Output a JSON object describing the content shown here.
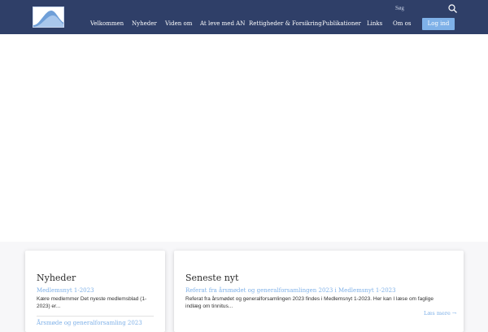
{
  "header": {
    "search_label": "Søg",
    "nav": [
      "Velkommen",
      "Nyheder",
      "Viden om",
      "At leve med AN",
      "Rettigheder & Forsikring",
      "Publikationer",
      "Links",
      "Om os"
    ],
    "login_label": "Log ind"
  },
  "news_card": {
    "title": "Nyheder",
    "items": [
      {
        "title": "Medlemsnyt 1-2023",
        "excerpt": "Kære medlemmer Det nyeste medlemsblad (1-2023) er..."
      },
      {
        "title": "Årsmøde og generalforsamling 2023",
        "excerpt": ""
      }
    ]
  },
  "latest_card": {
    "title": "Seneste nyt",
    "item_title": "Referat fra årsmødet og generalforsamlingen 2023 i Medlemsnyt 1-2023",
    "item_excerpt": "Referat fra årsmødet og generalforsamlingen 2023 findes i Medlemsnyt 1-2023. Her kan I læse om faglige indlæg om tinnitus...",
    "read_more": "Læs mere →"
  },
  "colors": {
    "header_bg": "#2f3f68",
    "accent": "#7fb1e8"
  }
}
